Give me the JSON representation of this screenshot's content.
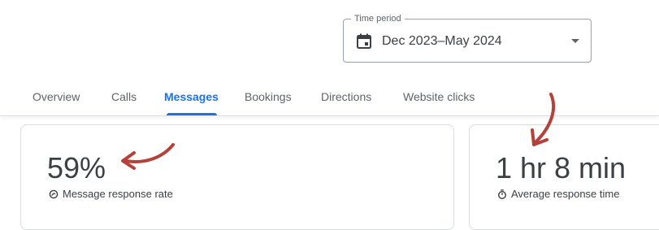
{
  "time_period": {
    "legend": "Time period",
    "value": "Dec 2023–May 2024",
    "icon": "calendar-icon"
  },
  "tabs": [
    {
      "label": "Overview",
      "active": false
    },
    {
      "label": "Calls",
      "active": false
    },
    {
      "label": "Messages",
      "active": true
    },
    {
      "label": "Bookings",
      "active": false
    },
    {
      "label": "Directions",
      "active": false
    },
    {
      "label": "Website clicks",
      "active": false
    }
  ],
  "metrics": [
    {
      "value": "59%",
      "label": "Message response rate",
      "icon": "response-rate-icon"
    },
    {
      "value": "1 hr 8 min",
      "label": "Average response time",
      "icon": "stopwatch-icon"
    }
  ],
  "colors": {
    "accent": "#1a73e8",
    "annotation_arrow": "#b5413b",
    "text": "#3c4043",
    "muted": "#5f6368",
    "border": "#dadce0"
  }
}
